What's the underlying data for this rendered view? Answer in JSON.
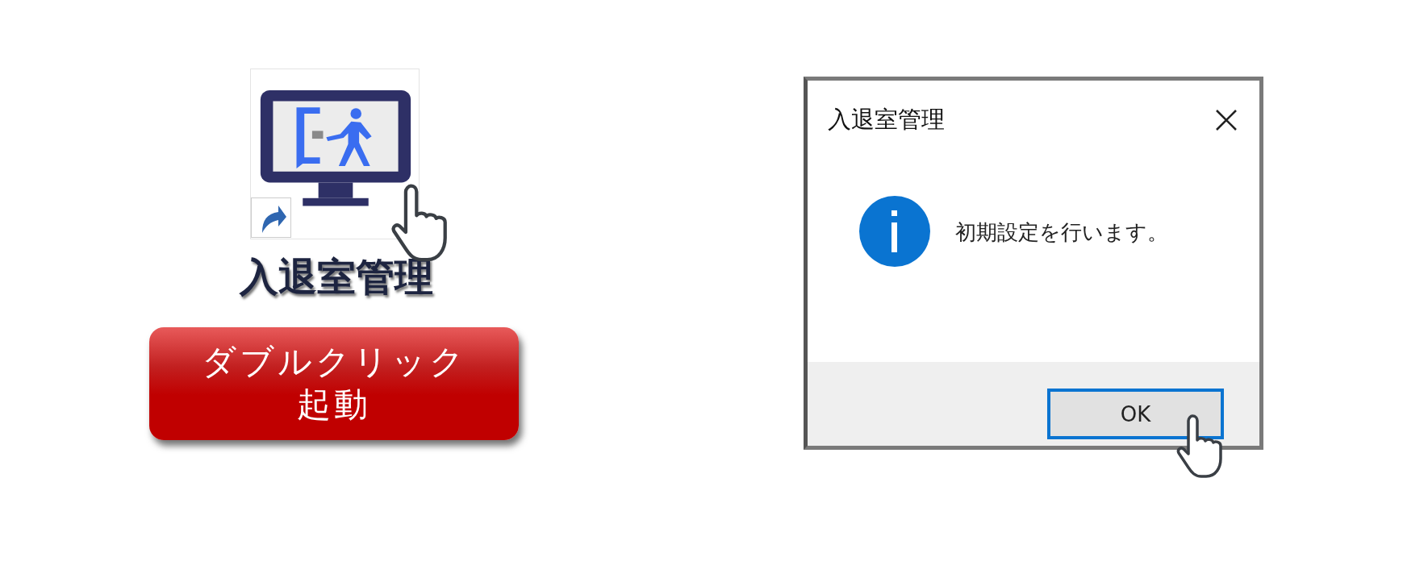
{
  "shortcut": {
    "label": "入退室管理"
  },
  "banner": {
    "lines": [
      "ダブルクリック",
      "起動"
    ]
  },
  "dialog": {
    "title": "入退室管理",
    "message": "初期設定を行います。",
    "buttons": [
      {
        "label": "OK",
        "focused": true
      }
    ]
  }
}
